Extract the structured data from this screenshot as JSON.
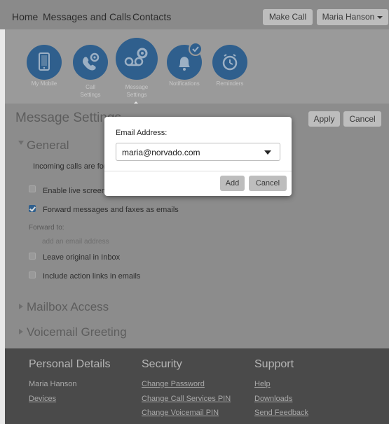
{
  "nav": {
    "home": "Home",
    "messages_calls": "Messages and Calls",
    "contacts": "Contacts",
    "make_call": "Make Call",
    "user": "Maria Hanson"
  },
  "toolbar": {
    "items": [
      {
        "label": "My Mobile",
        "icon": "mobile-phone-icon"
      },
      {
        "label": "Call Settings",
        "icon": "phone-gear-icon"
      },
      {
        "label": "Message Settings",
        "icon": "voicemail-gear-icon",
        "active": true
      },
      {
        "label": "Notifications",
        "icon": "bell-check-icon"
      },
      {
        "label": "Reminders",
        "icon": "alarm-clock-icon"
      }
    ]
  },
  "main": {
    "title": "Message Settings",
    "apply": "Apply",
    "cancel": "Cancel",
    "general": {
      "heading": "General",
      "incoming_text": "Incoming calls are for",
      "enable_live_screen": "Enable live screen",
      "forward_messages": "Forward messages and faxes as emails",
      "forward_to": "Forward to:",
      "add_email": "add an email address",
      "leave_original": "Leave original in Inbox",
      "include_action_links": "Include action links in emails"
    },
    "mailbox_access": "Mailbox Access",
    "voicemail_greeting": "Voicemail Greeting"
  },
  "modal": {
    "label": "Email Address:",
    "selected": "maria@norvado.com",
    "add": "Add",
    "cancel": "Cancel"
  },
  "footer": {
    "personal": {
      "heading": "Personal Details",
      "name": "Maria Hanson",
      "devices": "Devices"
    },
    "security": {
      "heading": "Security",
      "links": [
        "Change Password",
        "Change Call Services PIN",
        "Change Voicemail PIN"
      ]
    },
    "support": {
      "heading": "Support",
      "links": [
        "Help",
        "Downloads",
        "Send Feedback"
      ]
    }
  },
  "colors": {
    "accent": "#2f5f8d",
    "overlay": "#8a8a8a",
    "footer": "#4a4a4a"
  }
}
